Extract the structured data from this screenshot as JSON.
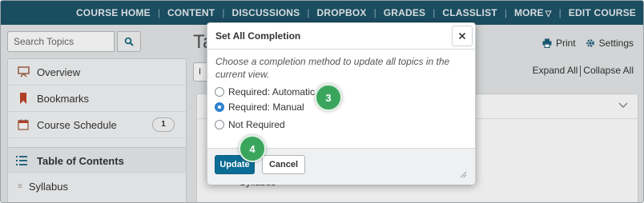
{
  "nav": {
    "items": [
      "COURSE HOME",
      "CONTENT",
      "DISCUSSIONS",
      "DROPBOX",
      "GRADES",
      "CLASSLIST"
    ],
    "more_label": "MORE",
    "edit_label": "EDIT COURSE",
    "bg_color": "#1e5469"
  },
  "sidebar": {
    "search_placeholder": "Search Topics",
    "items": [
      {
        "label": "Overview",
        "icon": "overview-icon"
      },
      {
        "label": "Bookmarks",
        "icon": "bookmark-icon"
      },
      {
        "label": "Course Schedule",
        "icon": "calendar-icon",
        "badge": "1"
      }
    ],
    "toc_label": "Table of Contents",
    "syllabus_label": "Syllabus"
  },
  "main": {
    "title_fragment": "Ta",
    "select_fragment": "I",
    "print_label": "Print",
    "settings_label": "Settings",
    "expand_all": "Expand All",
    "collapse_all": "Collapse All",
    "behind_item": "Syllabus"
  },
  "modal": {
    "title": "Set All Completion",
    "close_label": "×",
    "instruction": "Choose a completion method to update all topics in the current view.",
    "options": [
      {
        "label": "Required: Automatic",
        "selected": false
      },
      {
        "label": "Required: Manual",
        "selected": true
      },
      {
        "label": "Not Required",
        "selected": false
      }
    ],
    "update_label": "Update",
    "cancel_label": "Cancel",
    "primary_color": "#0b6d95"
  },
  "callouts": [
    "3",
    "4"
  ]
}
